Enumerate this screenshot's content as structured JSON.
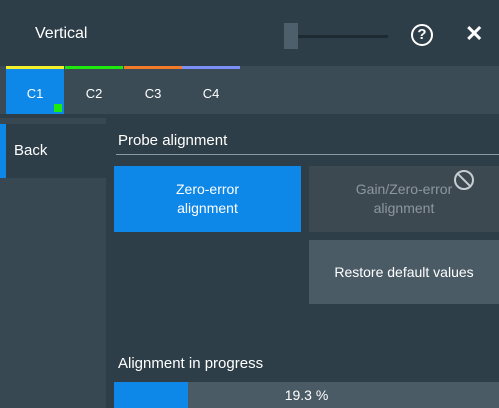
{
  "window": {
    "title": "Vertical"
  },
  "header_icons": {
    "help": "help-icon",
    "close": "close-icon",
    "close_glyph": "✕",
    "help_glyph": "?"
  },
  "tabs": [
    {
      "label": "C1",
      "color": "#f3ef2b",
      "active": true
    },
    {
      "label": "C2",
      "color": "#1fe80e",
      "active": false
    },
    {
      "label": "C3",
      "color": "#f07a26",
      "active": false
    },
    {
      "label": "C4",
      "color": "#7b8ef5",
      "active": false
    }
  ],
  "sidebar": {
    "back_label": "Back"
  },
  "section": {
    "title": "Probe alignment"
  },
  "buttons": {
    "zero_error": "Zero-error alignment",
    "gain_zero_error": "Gain/Zero-error alignment",
    "restore_defaults": "Restore default values"
  },
  "progress": {
    "label": "Alignment in progress",
    "value_text": "19.3 %",
    "value": 19.3
  },
  "colors": {
    "accent": "#0d87e8",
    "active_indicator": "#1fe80e"
  }
}
